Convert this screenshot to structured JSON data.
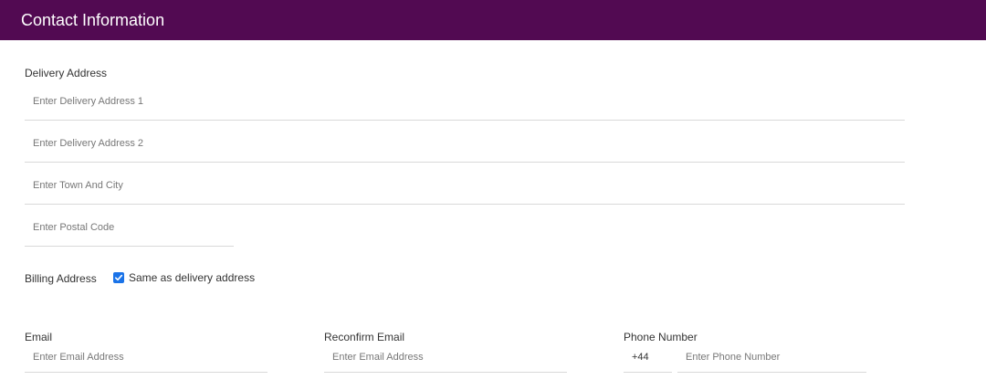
{
  "header": {
    "title": "Contact Information",
    "bg_color": "#520a52"
  },
  "delivery": {
    "label": "Delivery Address",
    "address1_placeholder": "Enter Delivery Address 1",
    "address2_placeholder": "Enter Delivery Address 2",
    "town_placeholder": "Enter Town And City",
    "postal_placeholder": "Enter Postal Code"
  },
  "billing": {
    "label": "Billing Address",
    "same_as_delivery_label": "Same as delivery address",
    "same_as_delivery_checked": true,
    "checkbox_color": "#1a73e8"
  },
  "contact": {
    "email_label": "Email",
    "email_placeholder": "Enter Email Address",
    "reconfirm_label": "Reconfirm Email",
    "reconfirm_placeholder": "Enter Email Address",
    "phone_label": "Phone Number",
    "phone_prefix": "+44",
    "phone_placeholder": "Enter Phone Number"
  }
}
